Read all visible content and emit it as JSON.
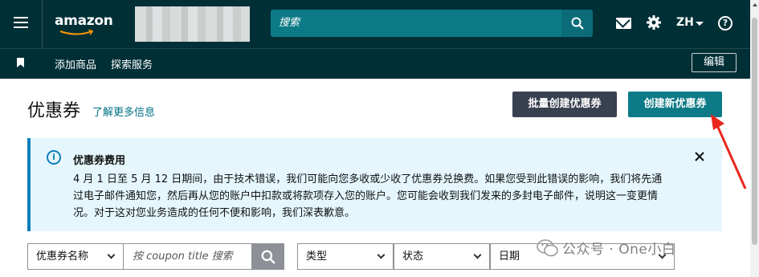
{
  "header": {
    "logo_text": "amazon",
    "search_placeholder": "搜索",
    "language": "ZH",
    "icons": [
      "menu-icon",
      "search-icon",
      "mail-icon",
      "gear-icon",
      "help-icon"
    ]
  },
  "subnav": {
    "items": [
      "添加商品",
      "探索服务"
    ],
    "edit_label": "编辑"
  },
  "page": {
    "title": "优惠券",
    "learn_more": "了解更多信息",
    "bulk_create_label": "批量创建优惠券",
    "create_new_label": "创建新优惠券"
  },
  "alert": {
    "title": "优惠券费用",
    "body": "4 月 1 日至 5 月 12 日期间，由于技术错误，我们可能向您多收或少收了优惠券兑换费。如果您受到此错误的影响，我们将先通过电子邮件通知您，然后再从您的账户中扣款或将款项存入您的账户。您可能会收到我们发来的多封电子邮件，说明这一变更情况。对于这对您业务造成的任何不便和影响，我们深表歉意。"
  },
  "filters": {
    "coupon_name_select": "优惠券名称",
    "coupon_search_placeholder": "按 coupon title 搜索",
    "type_select": "类型",
    "status_select": "状态",
    "date_select": "日期"
  },
  "watermark": {
    "text": "公众号 · One小白"
  },
  "colors": {
    "header_bg": "#002f36",
    "primary_teal": "#0d7a87",
    "secondary_dark": "#394150",
    "alert_bg": "#e5f6fd",
    "alert_border": "#0b7fba",
    "annotation_arrow": "#e8271d"
  }
}
